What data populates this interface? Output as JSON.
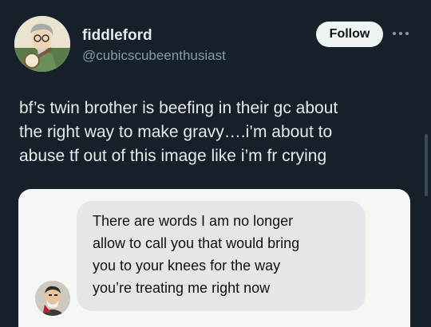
{
  "post": {
    "author": {
      "display_name": "fiddleford",
      "handle": "@cubicscubeenthusiast",
      "avatar_icon": "cartoon-avatar"
    },
    "follow_label": "Follow",
    "more_icon": "more-options-icon",
    "text_lines": [
      "bf’s twin brother    is   beefing in their gc about",
      "the right way to make gravy….i’m about to",
      "abuse tf out of this image like i’m fr crying"
    ]
  },
  "media": {
    "message_lines": [
      "There are words I am no longer",
      "allow to call you that would bring",
      "you to your knees for the way",
      "you’re treating me right now"
    ],
    "sender_avatar_icon": "cartoon-avatar"
  },
  "colors": {
    "background": "#15202b",
    "text": "#e7e9ea",
    "secondary_text": "#8b98a5",
    "follow_button": "#eff3f4",
    "bubble": "#e5e5ea",
    "media_background": "#f6f6f6"
  }
}
